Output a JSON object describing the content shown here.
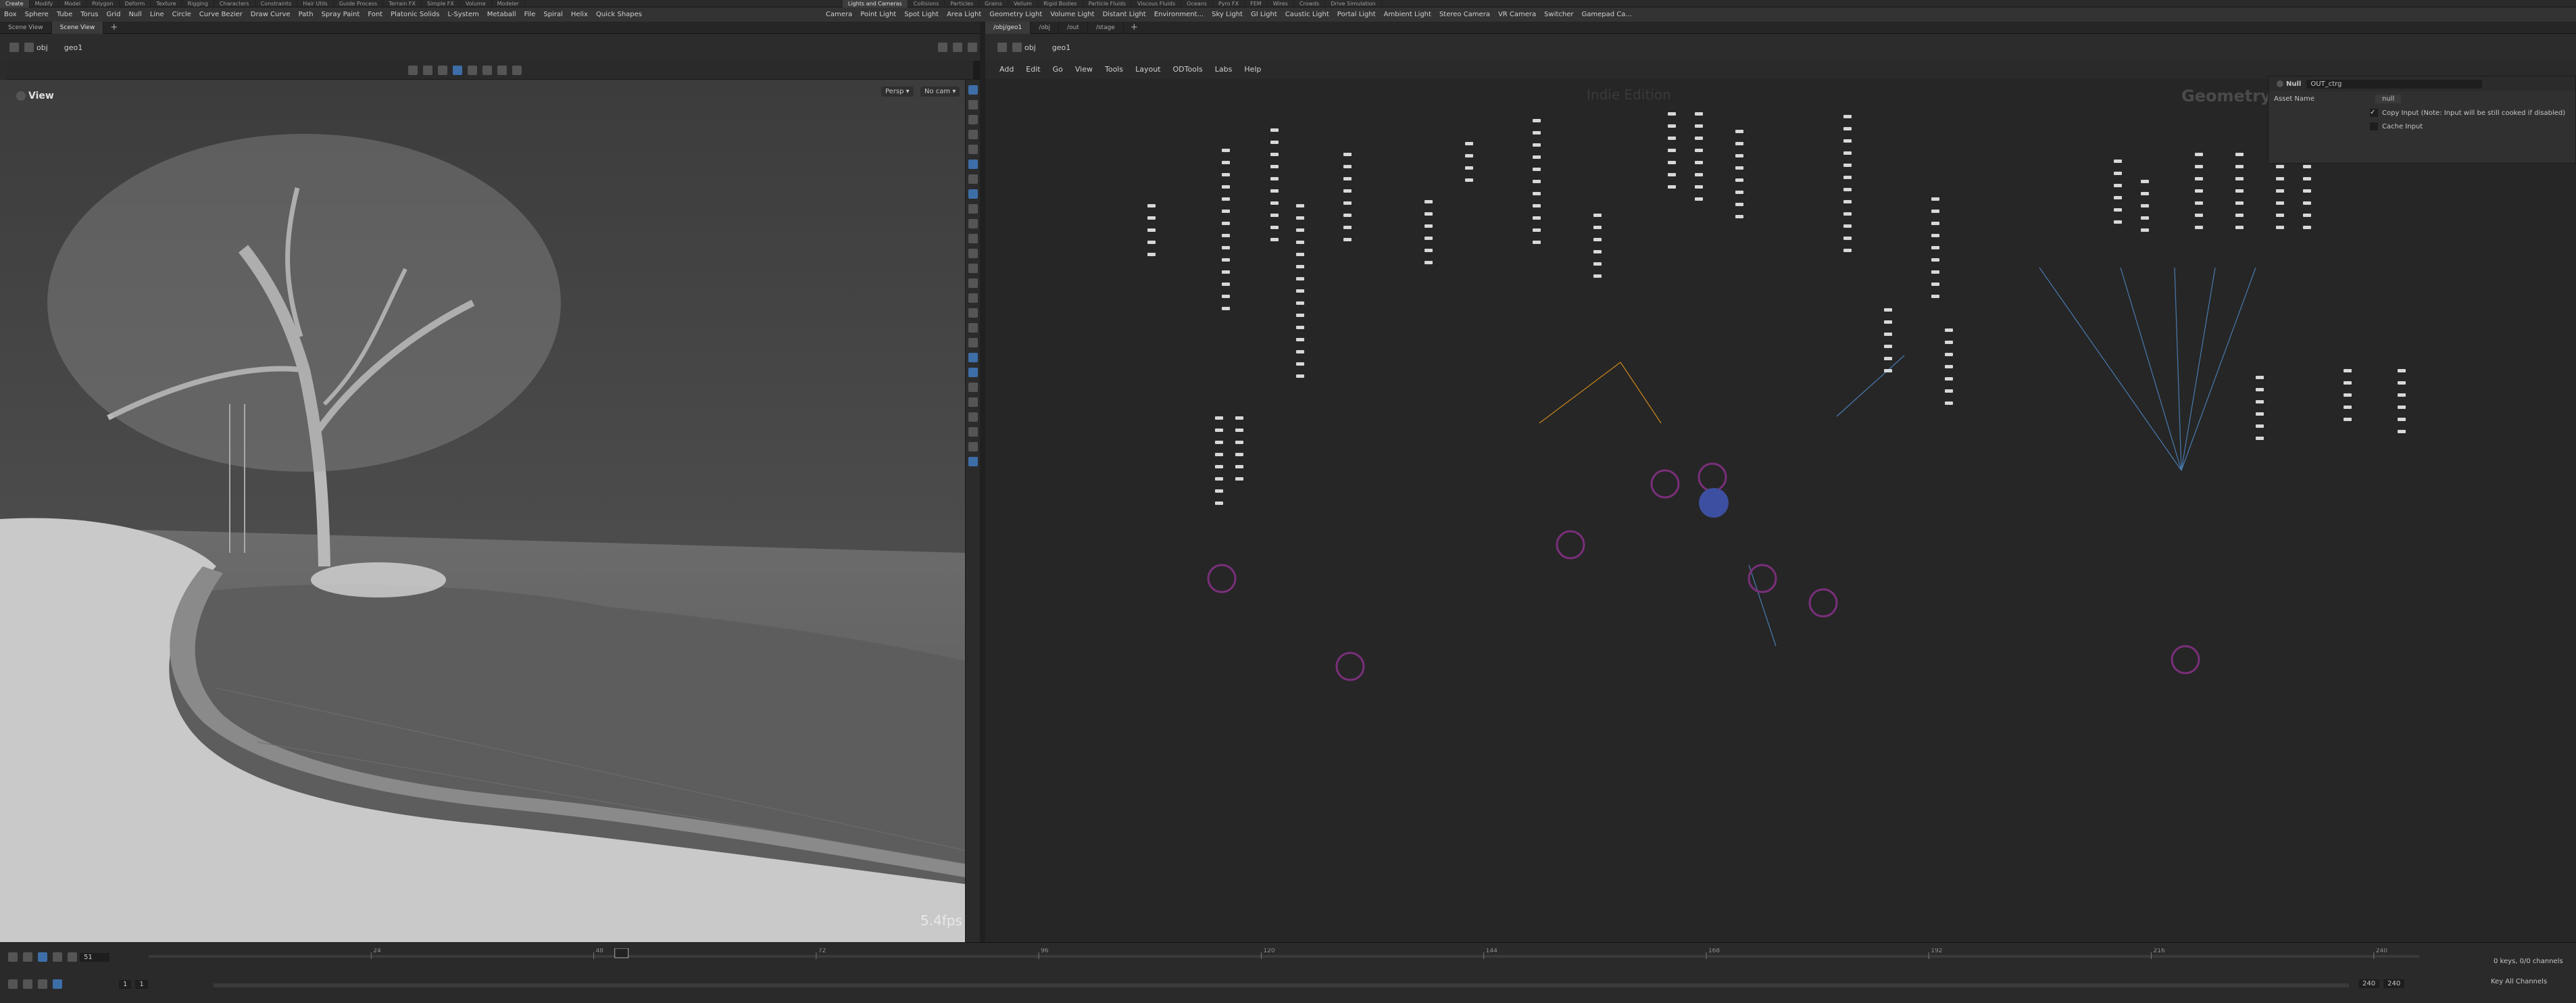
{
  "shelf": {
    "tabs": [
      "Create",
      "Modify",
      "Model",
      "Polygon",
      "Deform",
      "Texture",
      "Rigging",
      "Characters",
      "Constraints",
      "Hair Utils",
      "Guide Process",
      "Terrain FX",
      "Simple FX",
      "Volume",
      "Modeler"
    ],
    "tabs_right": [
      "Lights and Cameras",
      "Collisions",
      "Particles",
      "Grains",
      "Vellum",
      "Rigid Bodies",
      "Particle Fluids",
      "Viscous Fluids",
      "Oceans",
      "Pyro FX",
      "FEM",
      "Wires",
      "Crowds",
      "Drive Simulation"
    ],
    "tools": [
      "Box",
      "Sphere",
      "Tube",
      "Torus",
      "Grid",
      "Null",
      "Line",
      "Circle",
      "Curve Bezier",
      "Draw Curve",
      "Path",
      "Spray Paint",
      "Font",
      "Platonic Solids",
      "L-System",
      "Metaball",
      "File",
      "Spiral",
      "Helix",
      "Quick Shapes"
    ],
    "tools_right": [
      "Camera",
      "Point Light",
      "Spot Light",
      "Area Light",
      "Geometry Light",
      "Volume Light",
      "Distant Light",
      "Environment...",
      "Sky Light",
      "GI Light",
      "Caustic Light",
      "Portal Light",
      "Ambient Light",
      "Stereo Camera",
      "VR Camera",
      "Switcher",
      "Gamepad Ca..."
    ]
  },
  "left_pane": {
    "tabs": [
      "Scene View",
      "Scene View"
    ],
    "path": [
      "obj",
      "geo1"
    ],
    "viewport_label": "View",
    "persp": "Persp ▾",
    "cam": "No cam ▾",
    "fps": "5.4fps"
  },
  "right_pane": {
    "tabs": [
      "/obj/geo1",
      "/obj",
      "/out",
      "/stage"
    ],
    "path": [
      "obj",
      "geo1"
    ],
    "menu": [
      "Add",
      "Edit",
      "Go",
      "View",
      "Tools",
      "Layout",
      "ODTools",
      "Labs",
      "Help"
    ],
    "watermark": "Indie Edition",
    "context": "Geometry"
  },
  "param": {
    "type": "Null",
    "name": "OUT_ctrg",
    "asset_label": "Asset Name",
    "asset_value": "null",
    "copy_input": "Copy Input (Note: Input will be still cooked if disabled)",
    "cache_input": "Cache Input"
  },
  "timeline": {
    "frame": "51",
    "start": "1",
    "step": "1",
    "end1": "240",
    "end2": "240",
    "ticks": [
      "24",
      "48",
      "72",
      "96",
      "120",
      "144",
      "168",
      "192",
      "216",
      "240"
    ],
    "marker": "51",
    "keys": "0 keys, 0/0 channels",
    "key_all": "Key All Channels"
  },
  "colors": {
    "accent": "#3d6ea8",
    "node_ring": "#7a2f7a",
    "wire_blue": "#4a7ab0",
    "wire_orange": "#c9861a"
  }
}
